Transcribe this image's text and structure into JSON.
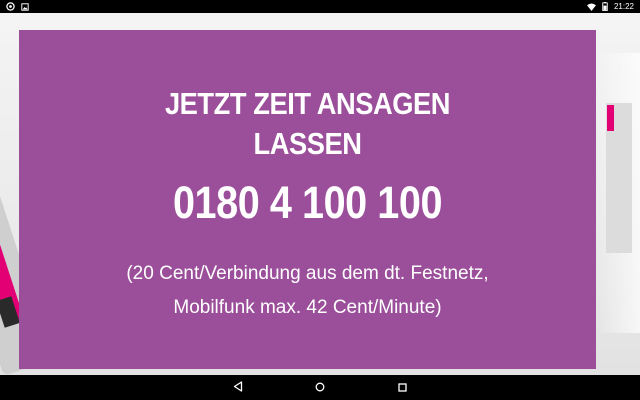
{
  "status_bar": {
    "time": "21:22",
    "icons": [
      "settings-icon",
      "image-icon",
      "wifi-icon",
      "battery-icon"
    ]
  },
  "card": {
    "headline_line1": "JETZT ZEIT ANSAGEN",
    "headline_line2": "LASSEN",
    "phone_number": "0180 4 100 100",
    "note_line1": "(20 Cent/Verbindung aus dem dt. Festnetz,",
    "note_line2": "Mobilfunk max. 42 Cent/Minute)",
    "background_color": "#9b4f9a"
  },
  "nav_bar": {
    "buttons": [
      "back-icon",
      "home-icon",
      "recents-icon"
    ]
  },
  "colors": {
    "brand_magenta": "#e20074",
    "card_purple": "#9b4f9a"
  }
}
